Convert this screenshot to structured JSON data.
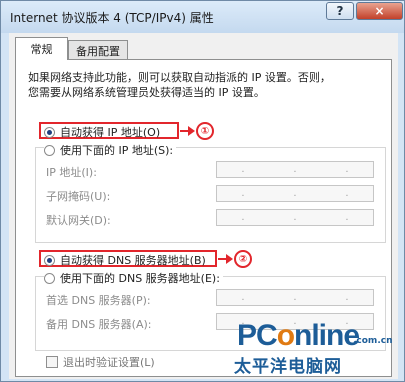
{
  "window": {
    "title": "Internet 协议版本 4 (TCP/IPv4) 属性",
    "help_label": "?",
    "close_label": "×"
  },
  "tabs": [
    {
      "label": "常规",
      "selected": true
    },
    {
      "label": "备用配置",
      "selected": false
    }
  ],
  "description": {
    "line1": "如果网络支持此功能，则可以获取自动指派的 IP 设置。否则，",
    "line2": "您需要从网络系统管理员处获得适当的 IP 设置。"
  },
  "ip": {
    "auto_label": "自动获得 IP 地址(O)",
    "manual_label": "使用下面的 IP 地址(S):",
    "auto_selected": true,
    "fields": [
      {
        "label": "IP 地址(I):"
      },
      {
        "label": "子网掩码(U):"
      },
      {
        "label": "默认网关(D):"
      }
    ]
  },
  "dns": {
    "auto_label": "自动获得 DNS 服务器地址(B)",
    "manual_label": "使用下面的 DNS 服务器地址(E):",
    "auto_selected": true,
    "fields": [
      {
        "label": "首选 DNS 服务器(P):"
      },
      {
        "label": "备用 DNS 服务器(A):"
      }
    ]
  },
  "validate": {
    "label": "退出时验证设置(L)",
    "checked": false
  },
  "annotations": {
    "marker1": "①",
    "marker2": "②",
    "color": "#e2262c"
  },
  "watermark": {
    "brand_pre": "PC",
    "brand_o": "o",
    "brand_post": "nline",
    "domain": ".com.cn",
    "subtitle": "太平洋电脑网"
  },
  "colors": {
    "accent": "#1d5d98",
    "highlight": "#e2262c"
  }
}
